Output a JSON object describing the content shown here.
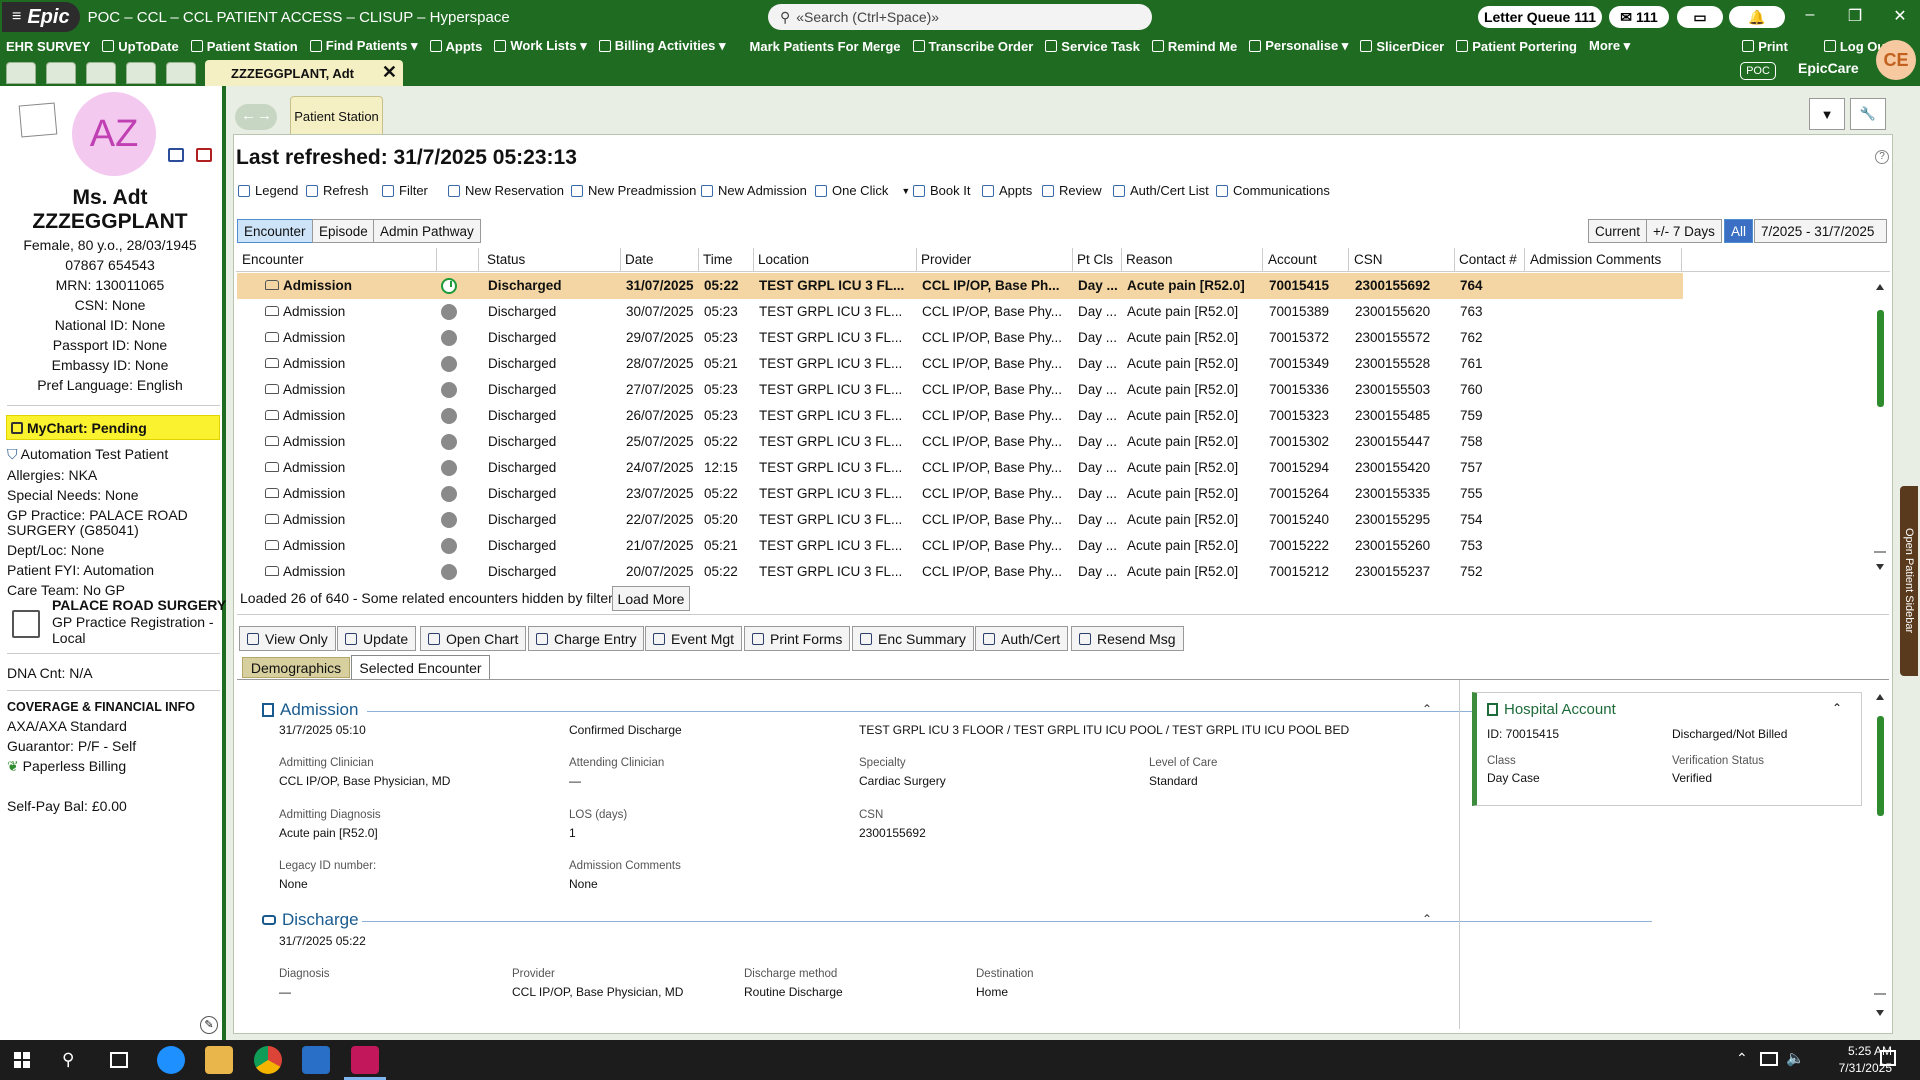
{
  "app": {
    "epic_label": "Epic",
    "title": "POC – CCL – CCL PATIENT ACCESS – CLISUP – Hyperspace",
    "search_placeholder": "«Search (Ctrl+Space)»",
    "letter_queue": "Letter Queue 111",
    "inbox_count": "111",
    "user_initials": "CE",
    "env_badge": "POC",
    "product": "EpicCare"
  },
  "toolbar": {
    "items": [
      "EHR SURVEY",
      "UpToDate",
      "Patient Station",
      "Find Patients ▾",
      "Appts",
      "Work Lists ▾",
      "Billing Activities ▾",
      "Mark Patients For Merge",
      "Transcribe Order",
      "Service Task",
      "Remind Me",
      "Personalise ▾",
      "SlicerDicer",
      "Patient Portering",
      "More ▾"
    ],
    "print": "Print",
    "logout": "Log Out"
  },
  "patient_tab": "ZZZEGGPLANT, Adt",
  "patient": {
    "initials": "AZ",
    "name_line1": "Ms. Adt",
    "name_line2": "ZZZEGGPLANT",
    "demo": "Female, 80 y.o., 28/03/1945",
    "phone": "07867 654543",
    "mrn": "MRN: 130011065",
    "csn": "CSN: None",
    "national_id": "National ID: None",
    "passport_id": "Passport ID: None",
    "embassy_id": "Embassy ID: None",
    "pref_language": "Pref Language: English",
    "mychart": "MyChart: Pending",
    "automation": "Automation Test Patient",
    "allergies": "Allergies: NKA",
    "special_needs": "Special Needs: None",
    "gp_practice_1": "GP Practice: PALACE ROAD",
    "gp_practice_2": "SURGERY (G85041)",
    "dept_loc": "Dept/Loc: None",
    "patient_fyi": "Patient FYI: Automation",
    "care_team": "Care Team: No GP",
    "practice_name": "PALACE ROAD SURGERY",
    "practice_reg_1": "GP Practice Registration -",
    "practice_reg_2": "Local",
    "dna": "DNA Cnt: N/A",
    "coverage_header": "COVERAGE & FINANCIAL INFO",
    "coverage": "AXA/AXA Standard",
    "guarantor": "Guarantor: P/F - Self",
    "paperless": "Paperless Billing",
    "self_pay": "Self-Pay Bal: £0.00"
  },
  "station": {
    "tab_label": "Patient Station",
    "last_refreshed": "Last refreshed: 31/7/2025 05:23:13",
    "actions": [
      "Legend",
      "Refresh",
      "Filter",
      "New Reservation",
      "New Preadmission",
      "New Admission",
      "One Click",
      "Book It",
      "Appts",
      "Review",
      "Auth/Cert List",
      "Communications"
    ],
    "view_tabs": [
      "Encounter",
      "Episode",
      "Admin Pathway"
    ],
    "range_buttons": [
      "Current",
      "+/- 7 Days",
      "All"
    ],
    "date_range": "7/2025 - 31/7/2025"
  },
  "table": {
    "columns": [
      "Encounter",
      "Status",
      "Date",
      "Time",
      "Location",
      "Provider",
      "Pt Cls",
      "Reason",
      "Account",
      "CSN",
      "Contact #",
      "Admission Comments"
    ],
    "rows": [
      [
        "Admission",
        "Discharged",
        "31/07/2025",
        "05:22",
        "TEST GRPL ICU 3 FL...",
        "CCL IP/OP, Base Ph...",
        "Day ...",
        "Acute pain [R52.0]",
        "70015415",
        "2300155692",
        "764"
      ],
      [
        "Admission",
        "Discharged",
        "30/07/2025",
        "05:23",
        "TEST GRPL ICU 3 FL...",
        "CCL IP/OP, Base Phy...",
        "Day ...",
        "Acute pain [R52.0]",
        "70015389",
        "2300155620",
        "763"
      ],
      [
        "Admission",
        "Discharged",
        "29/07/2025",
        "05:23",
        "TEST GRPL ICU 3 FL...",
        "CCL IP/OP, Base Phy...",
        "Day ...",
        "Acute pain [R52.0]",
        "70015372",
        "2300155572",
        "762"
      ],
      [
        "Admission",
        "Discharged",
        "28/07/2025",
        "05:21",
        "TEST GRPL ICU 3 FL...",
        "CCL IP/OP, Base Phy...",
        "Day ...",
        "Acute pain [R52.0]",
        "70015349",
        "2300155528",
        "761"
      ],
      [
        "Admission",
        "Discharged",
        "27/07/2025",
        "05:23",
        "TEST GRPL ICU 3 FL...",
        "CCL IP/OP, Base Phy...",
        "Day ...",
        "Acute pain [R52.0]",
        "70015336",
        "2300155503",
        "760"
      ],
      [
        "Admission",
        "Discharged",
        "26/07/2025",
        "05:23",
        "TEST GRPL ICU 3 FL...",
        "CCL IP/OP, Base Phy...",
        "Day ...",
        "Acute pain [R52.0]",
        "70015323",
        "2300155485",
        "759"
      ],
      [
        "Admission",
        "Discharged",
        "25/07/2025",
        "05:22",
        "TEST GRPL ICU 3 FL...",
        "CCL IP/OP, Base Phy...",
        "Day ...",
        "Acute pain [R52.0]",
        "70015302",
        "2300155447",
        "758"
      ],
      [
        "Admission",
        "Discharged",
        "24/07/2025",
        "12:15",
        "TEST GRPL ICU 3 FL...",
        "CCL IP/OP, Base Phy...",
        "Day ...",
        "Acute pain [R52.0]",
        "70015294",
        "2300155420",
        "757"
      ],
      [
        "Admission",
        "Discharged",
        "23/07/2025",
        "05:22",
        "TEST GRPL ICU 3 FL...",
        "CCL IP/OP, Base Phy...",
        "Day ...",
        "Acute pain [R52.0]",
        "70015264",
        "2300155335",
        "755"
      ],
      [
        "Admission",
        "Discharged",
        "22/07/2025",
        "05:20",
        "TEST GRPL ICU 3 FL...",
        "CCL IP/OP, Base Phy...",
        "Day ...",
        "Acute pain [R52.0]",
        "70015240",
        "2300155295",
        "754"
      ],
      [
        "Admission",
        "Discharged",
        "21/07/2025",
        "05:21",
        "TEST GRPL ICU 3 FL...",
        "CCL IP/OP, Base Phy...",
        "Day ...",
        "Acute pain [R52.0]",
        "70015222",
        "2300155260",
        "753"
      ],
      [
        "Admission",
        "Discharged",
        "20/07/2025",
        "05:22",
        "TEST GRPL ICU 3 FL...",
        "CCL IP/OP, Base Phy...",
        "Day ...",
        "Acute pain [R52.0]",
        "70015212",
        "2300155237",
        "752"
      ]
    ],
    "loaded": "Loaded 26 of 640 - Some related encounters hidden by filters.",
    "load_more": "Load More"
  },
  "bottom_actions": [
    "View Only",
    "Update",
    "Open Chart",
    "Charge Entry",
    "Event Mgt",
    "Print Forms",
    "Enc Summary",
    "Auth/Cert",
    "Resend Msg"
  ],
  "detail_tabs": [
    "Demographics",
    "Selected Encounter"
  ],
  "admission": {
    "header": "Admission",
    "datetime": "31/7/2025 05:10",
    "status": "Confirmed Discharge",
    "location": "TEST GRPL ICU 3 FLOOR / TEST GRPL ITU ICU POOL / TEST GRPL ITU ICU POOL BED",
    "admitting_clinician_label": "Admitting Clinician",
    "admitting_clinician": "CCL IP/OP, Base Physician, MD",
    "attending_label": "Attending Clinician",
    "attending": "—",
    "specialty_label": "Specialty",
    "specialty": "Cardiac Surgery",
    "level_label": "Level of Care",
    "level": "Standard",
    "diag_label": "Admitting Diagnosis",
    "diag": "Acute pain [R52.0]",
    "los_label": "LOS (days)",
    "los": "1",
    "csn_label": "CSN",
    "csn": "2300155692",
    "legacy_label": "Legacy ID number:",
    "legacy": "None",
    "comments_label": "Admission Comments",
    "comments": "None"
  },
  "discharge": {
    "header": "Discharge",
    "datetime": "31/7/2025 05:22",
    "diag_label": "Diagnosis",
    "diag": "—",
    "provider_label": "Provider",
    "provider": "CCL IP/OP, Base Physician, MD",
    "method_label": "Discharge method",
    "method": "Routine Discharge",
    "dest_label": "Destination",
    "dest": "Home"
  },
  "hospital_account": {
    "header": "Hospital Account",
    "id": "ID: 70015415",
    "billing": "Discharged/Not Billed",
    "class_label": "Class",
    "class": "Day Case",
    "verif_label": "Verification Status",
    "verif": "Verified"
  },
  "right_rail": "Open Patient Sidebar",
  "taskbar": {
    "time": "5:25 AM",
    "date": "7/31/2025"
  },
  "colors": {
    "epic_green": "#1f6b22",
    "selected_row": "#f3d6a3",
    "mychart_yellow": "#fbf22f"
  }
}
